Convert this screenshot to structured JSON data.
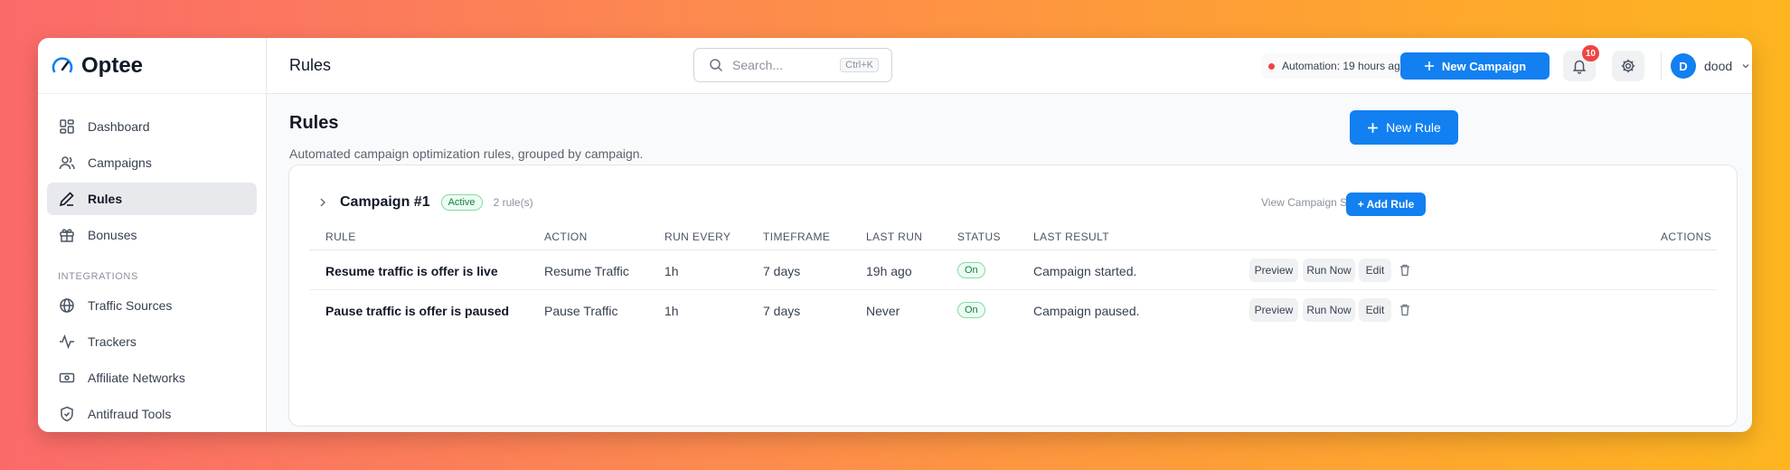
{
  "brand": {
    "name": "Optee"
  },
  "sidebar": {
    "items": [
      {
        "label": "Dashboard",
        "icon": "dashboard-icon"
      },
      {
        "label": "Campaigns",
        "icon": "users-icon"
      },
      {
        "label": "Rules",
        "icon": "pen-icon",
        "active": true
      },
      {
        "label": "Bonuses",
        "icon": "gift-icon"
      }
    ],
    "section_label": "INTEGRATIONS",
    "integrations": [
      {
        "label": "Traffic Sources",
        "icon": "globe-icon"
      },
      {
        "label": "Trackers",
        "icon": "activity-icon"
      },
      {
        "label": "Affiliate Networks",
        "icon": "money-icon"
      },
      {
        "label": "Antifraud Tools",
        "icon": "shield-icon"
      }
    ]
  },
  "header": {
    "title": "Rules",
    "search_placeholder": "Search...",
    "search_shortcut": "Ctrl+K",
    "automation_status": "Automation: 19 hours ago",
    "new_campaign_label": "New Campaign",
    "notification_count": "10",
    "user": {
      "initial": "D",
      "name": "dood"
    }
  },
  "page": {
    "title": "Rules",
    "subtitle": "Automated campaign optimization rules, grouped by campaign.",
    "new_rule_label": "New Rule"
  },
  "campaign": {
    "name": "Campaign #1",
    "status": "Active",
    "rule_count": "2 rule(s)",
    "view_stats_label": "View Campaign Stats",
    "add_rule_label": "+ Add Rule",
    "columns": [
      "RULE",
      "ACTION",
      "RUN EVERY",
      "TIMEFRAME",
      "LAST RUN",
      "STATUS",
      "LAST RESULT",
      "ACTIONS"
    ],
    "rows": [
      {
        "rule": "Resume traffic is offer is live",
        "action": "Resume Traffic",
        "run_every": "1h",
        "timeframe": "7 days",
        "last_run": "19h ago",
        "status": "On",
        "last_result": "Campaign started."
      },
      {
        "rule": "Pause traffic is offer is paused",
        "action": "Pause Traffic",
        "run_every": "1h",
        "timeframe": "7 days",
        "last_run": "Never",
        "status": "On",
        "last_result": "Campaign paused."
      }
    ],
    "row_actions": {
      "preview": "Preview",
      "run_now": "Run Now",
      "edit": "Edit"
    }
  },
  "colors": {
    "accent": "#1280f0",
    "success": "#15803d",
    "danger": "#ef4444"
  }
}
